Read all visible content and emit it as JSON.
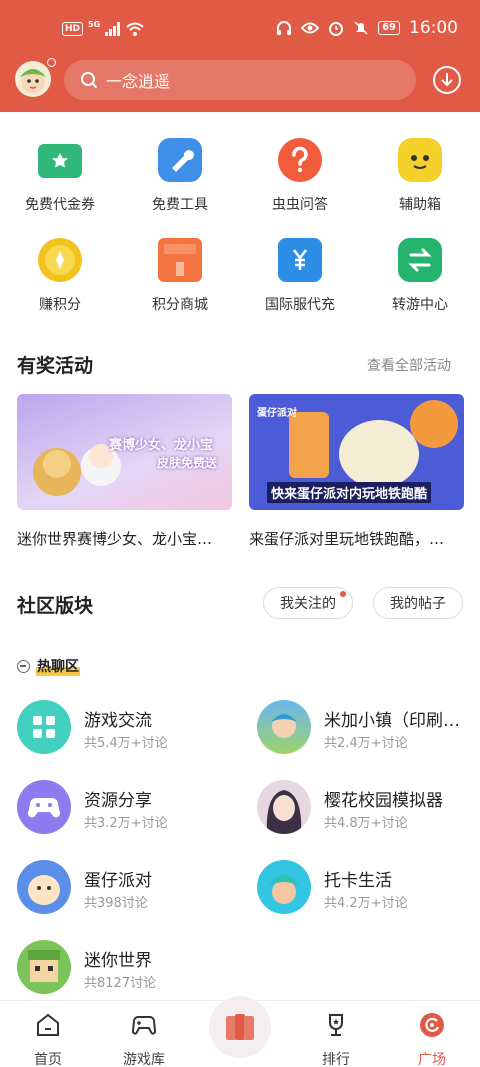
{
  "status_bar": {
    "net1": "HD",
    "net2": "5G",
    "battery": "69",
    "time": "16:00"
  },
  "search": {
    "placeholder": "一念逍遥"
  },
  "quick_grid": [
    {
      "label": "免费代金券",
      "icon": "ticket-icon",
      "color": "#2fb87a"
    },
    {
      "label": "免费工具",
      "icon": "toolbox-icon",
      "color": "#3d8fe8"
    },
    {
      "label": "虫虫问答",
      "icon": "question-icon",
      "color": "#f25c3c"
    },
    {
      "label": "辅助箱",
      "icon": "robot-icon",
      "color": "#f4d12a"
    },
    {
      "label": "赚积分",
      "icon": "coin-icon",
      "color": "#f2c21f"
    },
    {
      "label": "积分商城",
      "icon": "shop-icon",
      "color": "#f3743e"
    },
    {
      "label": "国际服代充",
      "icon": "wallet-icon",
      "color": "#2d8ee6"
    },
    {
      "label": "转游中心",
      "icon": "transfer-icon",
      "color": "#25b46d"
    }
  ],
  "activities": {
    "title": "有奖活动",
    "more": "查看全部活动",
    "banners": [
      {
        "overlay_text": "赛博少女、龙小宝",
        "overlay_text2": "皮肤免费送",
        "caption": "迷你世界赛博少女、龙小宝…",
        "color": "#c9b7ee"
      },
      {
        "overlay_text": "快来蛋仔派对内玩地铁跑酷",
        "badge": "蛋仔派对",
        "caption": "来蛋仔派对里玩地铁跑酷，…",
        "color": "#4c5bd6"
      }
    ]
  },
  "community": {
    "title": "社区版块",
    "follow_label": "我关注的",
    "posts_label": "我的帖子",
    "hot_label": "热聊区",
    "forums": [
      {
        "name": "游戏交流",
        "sub": "共5.4万+讨论",
        "icon": "grid-icon",
        "color": "#43d0c0"
      },
      {
        "name": "米加小镇（印刷…",
        "sub": "共2.4万+讨论",
        "icon": "game-avatar-icon",
        "color": "#6ab6f0"
      },
      {
        "name": "资源分享",
        "sub": "共3.2万+讨论",
        "icon": "gamepad-icon",
        "color": "#8c7cf0"
      },
      {
        "name": "樱花校园模拟器",
        "sub": "共4.8万+讨论",
        "icon": "game-avatar-icon",
        "color": "#e7d7e0"
      },
      {
        "name": "蛋仔派对",
        "sub": "共398讨论",
        "icon": "game-avatar-icon",
        "color": "#5b8ee8"
      },
      {
        "name": "托卡生活",
        "sub": "共4.2万+讨论",
        "icon": "game-avatar-icon",
        "color": "#33c6e3"
      },
      {
        "name": "迷你世界",
        "sub": "共8127讨论",
        "icon": "game-avatar-icon",
        "color": "#7cc35a"
      }
    ]
  },
  "tabbar": [
    {
      "label": "首页",
      "icon": "home-icon"
    },
    {
      "label": "游戏库",
      "icon": "gamepad-icon"
    },
    {
      "label": "",
      "icon": "cards-icon"
    },
    {
      "label": "排行",
      "icon": "trophy-icon"
    },
    {
      "label": "广场",
      "icon": "plaza-icon"
    }
  ],
  "colors": {
    "brand": "#e05a45"
  }
}
